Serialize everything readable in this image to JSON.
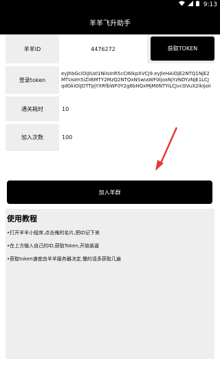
{
  "status_bar": {
    "time": "9:13"
  },
  "app_bar": {
    "title": "羊羊飞升助手"
  },
  "form": {
    "id_label": "羊羊ID",
    "id_value": "4476272",
    "get_token_label": "获取TOKEN",
    "token_label": "登录token",
    "token_value": "eyJhbGciOiJIUzI1NiIsInR5cCI6IkpXVCJ9.eyJleHAiOjE2NTQ1NjE2MTUsIm5iZiI6MTY2MzQ2NTQxNSwiaWF0IjoxNjYzNDYzNjE1LCJqdGkiOiJDTTpjYXRfbWF0Y2g6bHQxMjM0NTYiLCJvcGVuX2lkIjoii",
    "time_label": "通关耗时",
    "time_value": "10",
    "count_label": "加入次数",
    "count_value": "100"
  },
  "join_button": {
    "label": "加入羊群"
  },
  "tutorial": {
    "title": "使用教程",
    "steps": [
      "•打开羊羊小程序,点击俺的名片,把ID记下来",
      "•在上方输入自己的ID,获取Token,开始装逼",
      "•获取token速度由羊羊服务器决定,慢的话多获取几遍"
    ]
  },
  "colors": {
    "arrow": "#e53935",
    "bar": "#000000",
    "label_bg": "#eeeeee"
  }
}
